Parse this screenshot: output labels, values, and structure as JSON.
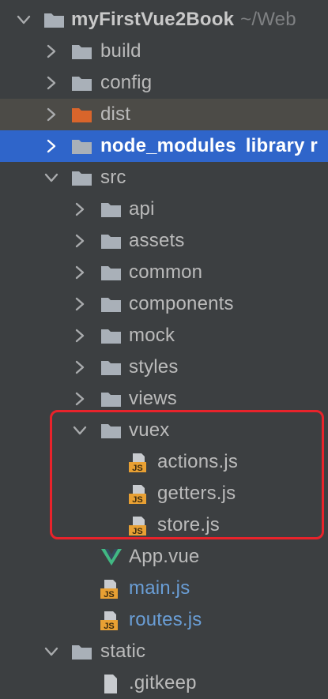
{
  "root": {
    "name": "myFirstVue2Book",
    "path": "~/Web"
  },
  "items": [
    {
      "label": "build"
    },
    {
      "label": "config"
    },
    {
      "label": "dist"
    },
    {
      "label": "node_modules",
      "note": "library r"
    },
    {
      "label": "src"
    },
    {
      "label": "api"
    },
    {
      "label": "assets"
    },
    {
      "label": "common"
    },
    {
      "label": "components"
    },
    {
      "label": "mock"
    },
    {
      "label": "styles"
    },
    {
      "label": "views"
    },
    {
      "label": "vuex"
    },
    {
      "label": "actions.js"
    },
    {
      "label": "getters.js"
    },
    {
      "label": "store.js"
    },
    {
      "label": "App.vue"
    },
    {
      "label": "main.js"
    },
    {
      "label": "routes.js"
    },
    {
      "label": "static"
    },
    {
      "label": ".gitkeep"
    }
  ],
  "file_badge_text": "JS",
  "colors": {
    "background": "#3c3f41",
    "selected_row": "#2f65ca",
    "excluded_folder": "#d9652b",
    "folder": "#a9b0b8",
    "js_badge": "#e8a033",
    "vue_icon": "#41b883",
    "modified_file_text": "#6a9ed6",
    "highlight_border": "#e8232b"
  },
  "icons": {
    "expanded": "chevron-down-icon",
    "collapsed": "chevron-right-icon",
    "folder": "folder-icon",
    "js_file": "js-file-icon",
    "vue_file": "vue-file-icon"
  }
}
